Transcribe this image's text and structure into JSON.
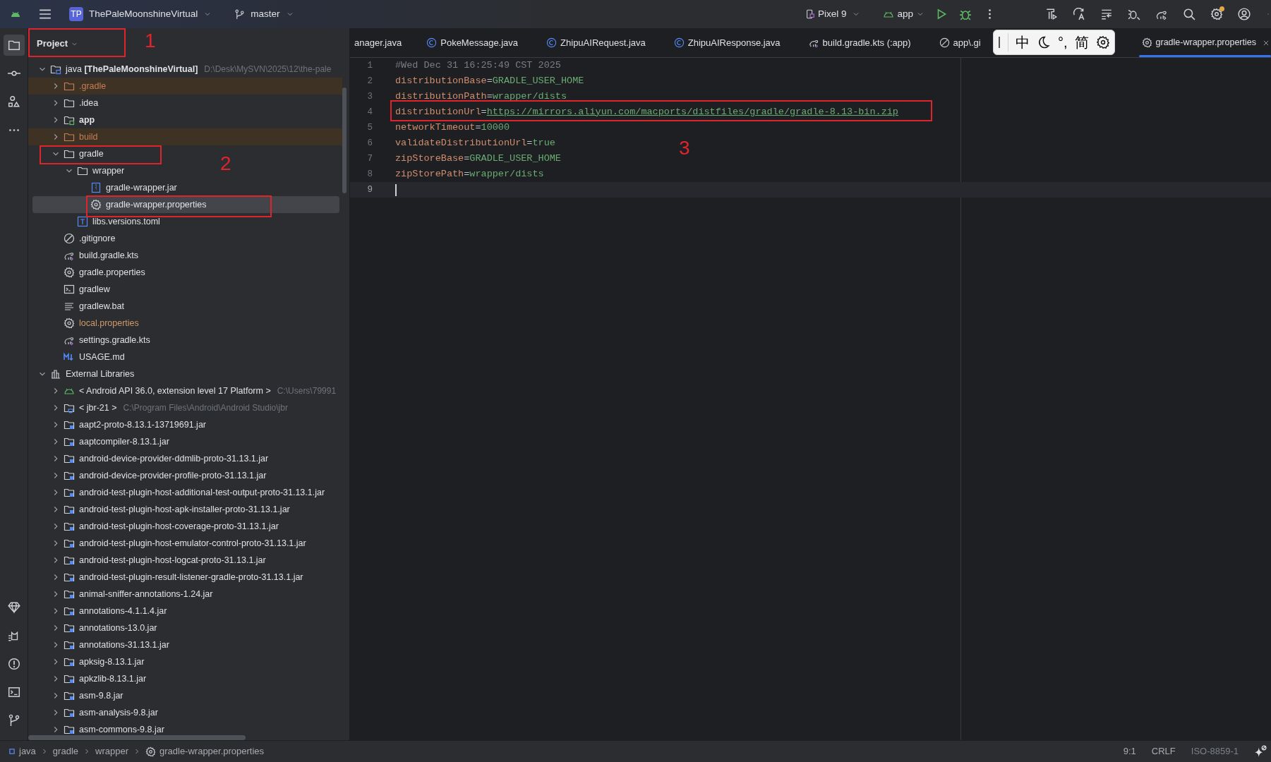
{
  "title_bar": {
    "project_badge": "TP",
    "project": "ThePaleMoonshineVirtual",
    "branch": "master",
    "device": "Pixel 9",
    "run_config": "app",
    "settings_notification": true
  },
  "project_panel": {
    "title": "Project"
  },
  "tree": [
    {
      "label": "java **[ThePaleMoonshineVirtual]**",
      "path": "D:\\Desk\\MySVN\\2025\\12\\the-pale",
      "kind": "module",
      "expanded": true,
      "excluded": false,
      "ignored": false,
      "selected": false,
      "children": [
        {
          "label": ".gradle",
          "kind": "folder",
          "expanded": false,
          "excluded": true,
          "ignored": false,
          "selected": false
        },
        {
          "label": ".idea",
          "kind": "folder",
          "expanded": false,
          "excluded": false,
          "ignored": false,
          "selected": false
        },
        {
          "label": "app",
          "kind": "app-module",
          "expanded": false,
          "excluded": false,
          "ignored": false,
          "selected": false
        },
        {
          "label": "build",
          "kind": "folder",
          "expanded": false,
          "excluded": true,
          "ignored": false,
          "selected": false
        },
        {
          "label": "gradle",
          "kind": "folder",
          "expanded": true,
          "excluded": false,
          "ignored": false,
          "selected": false,
          "children": [
            {
              "label": "wrapper",
              "kind": "folder",
              "expanded": true,
              "excluded": false,
              "ignored": false,
              "selected": false,
              "children": [
                {
                  "label": "gradle-wrapper.jar",
                  "kind": "jar",
                  "excluded": false,
                  "ignored": false,
                  "selected": false
                },
                {
                  "label": "gradle-wrapper.properties",
                  "kind": "properties",
                  "excluded": false,
                  "ignored": false,
                  "selected": true
                }
              ]
            },
            {
              "label": "libs.versions.toml",
              "kind": "toml",
              "excluded": false,
              "ignored": false,
              "selected": false
            }
          ]
        },
        {
          "label": ".gitignore",
          "kind": "ignore",
          "excluded": false,
          "ignored": false,
          "selected": false
        },
        {
          "label": "build.gradle.kts",
          "kind": "gradle-script",
          "excluded": false,
          "ignored": false,
          "selected": false
        },
        {
          "label": "gradle.properties",
          "kind": "properties",
          "excluded": false,
          "ignored": false,
          "selected": false
        },
        {
          "label": "gradlew",
          "kind": "shell",
          "excluded": false,
          "ignored": false,
          "selected": false
        },
        {
          "label": "gradlew.bat",
          "kind": "text",
          "excluded": false,
          "ignored": false,
          "selected": false
        },
        {
          "label": "local.properties",
          "kind": "properties",
          "excluded": false,
          "ignored": true,
          "selected": false
        },
        {
          "label": "settings.gradle.kts",
          "kind": "gradle-script",
          "excluded": false,
          "ignored": false,
          "selected": false
        },
        {
          "label": "USAGE.md",
          "kind": "markdown",
          "excluded": false,
          "ignored": false,
          "selected": false
        }
      ]
    },
    {
      "label": "External Libraries",
      "kind": "libraries",
      "expanded": true,
      "excluded": false,
      "ignored": false,
      "selected": false,
      "children": [
        {
          "label": "< Android API 36.0, extension level 17 Platform >",
          "path": "C:\\Users\\79991",
          "kind": "android",
          "expanded": false,
          "excluded": false,
          "ignored": false,
          "selected": false
        },
        {
          "label": "< jbr-21 >",
          "path": "C:\\Program Files\\Android\\Android Studio\\jbr",
          "kind": "sdk",
          "expanded": false,
          "excluded": false,
          "ignored": false,
          "selected": false
        },
        {
          "label": "aapt2-proto-8.13.1-13719691.jar",
          "kind": "library",
          "expanded": false,
          "excluded": false,
          "ignored": false,
          "selected": false
        },
        {
          "label": "aaptcompiler-8.13.1.jar",
          "kind": "library",
          "expanded": false,
          "excluded": false,
          "ignored": false,
          "selected": false
        },
        {
          "label": "android-device-provider-ddmlib-proto-31.13.1.jar",
          "kind": "library",
          "expanded": false,
          "excluded": false,
          "ignored": false,
          "selected": false
        },
        {
          "label": "android-device-provider-profile-proto-31.13.1.jar",
          "kind": "library",
          "expanded": false,
          "excluded": false,
          "ignored": false,
          "selected": false
        },
        {
          "label": "android-test-plugin-host-additional-test-output-proto-31.13.1.jar",
          "kind": "library",
          "expanded": false,
          "excluded": false,
          "ignored": false,
          "selected": false
        },
        {
          "label": "android-test-plugin-host-apk-installer-proto-31.13.1.jar",
          "kind": "library",
          "expanded": false,
          "excluded": false,
          "ignored": false,
          "selected": false
        },
        {
          "label": "android-test-plugin-host-coverage-proto-31.13.1.jar",
          "kind": "library",
          "expanded": false,
          "excluded": false,
          "ignored": false,
          "selected": false
        },
        {
          "label": "android-test-plugin-host-emulator-control-proto-31.13.1.jar",
          "kind": "library",
          "expanded": false,
          "excluded": false,
          "ignored": false,
          "selected": false
        },
        {
          "label": "android-test-plugin-host-logcat-proto-31.13.1.jar",
          "kind": "library",
          "expanded": false,
          "excluded": false,
          "ignored": false,
          "selected": false
        },
        {
          "label": "android-test-plugin-result-listener-gradle-proto-31.13.1.jar",
          "kind": "library",
          "expanded": false,
          "excluded": false,
          "ignored": false,
          "selected": false
        },
        {
          "label": "animal-sniffer-annotations-1.24.jar",
          "kind": "library",
          "expanded": false,
          "excluded": false,
          "ignored": false,
          "selected": false
        },
        {
          "label": "annotations-4.1.1.4.jar",
          "kind": "library",
          "expanded": false,
          "excluded": false,
          "ignored": false,
          "selected": false
        },
        {
          "label": "annotations-13.0.jar",
          "kind": "library",
          "expanded": false,
          "excluded": false,
          "ignored": false,
          "selected": false
        },
        {
          "label": "annotations-31.13.1.jar",
          "kind": "library",
          "expanded": false,
          "excluded": false,
          "ignored": false,
          "selected": false
        },
        {
          "label": "apksig-8.13.1.jar",
          "kind": "library",
          "expanded": false,
          "excluded": false,
          "ignored": false,
          "selected": false
        },
        {
          "label": "apkzlib-8.13.1.jar",
          "kind": "library",
          "expanded": false,
          "excluded": false,
          "ignored": false,
          "selected": false
        },
        {
          "label": "asm-9.8.jar",
          "kind": "library",
          "expanded": false,
          "excluded": false,
          "ignored": false,
          "selected": false
        },
        {
          "label": "asm-analysis-9.8.jar",
          "kind": "library",
          "expanded": false,
          "excluded": false,
          "ignored": false,
          "selected": false
        },
        {
          "label": "asm-commons-9.8.jar",
          "kind": "library",
          "expanded": false,
          "excluded": false,
          "ignored": false,
          "selected": false
        }
      ]
    }
  ],
  "tabs": [
    {
      "label": "anager.java",
      "kind": "none",
      "selected": false
    },
    {
      "label": "PokeMessage.java",
      "kind": "class",
      "selected": false
    },
    {
      "label": "ZhipuAIRequest.java",
      "kind": "class",
      "selected": false
    },
    {
      "label": "ZhipuAIResponse.java",
      "kind": "class",
      "selected": false
    },
    {
      "label": "build.gradle.kts (:app)",
      "kind": "gradle-script",
      "selected": false
    },
    {
      "label": "app\\.gi",
      "kind": "ignore",
      "selected": false
    },
    {
      "label": "gradle-wrapper.properties",
      "kind": "properties",
      "selected": true
    }
  ],
  "ime_toolbar": {
    "items": [
      "中",
      "°,",
      "简"
    ]
  },
  "editor_lines": [
    {
      "number": "1",
      "kind": "comment",
      "text": "#Wed Dec 31 16:25:49 CST 2025",
      "current": false
    },
    {
      "number": "2",
      "kind": "property",
      "key": "distributionBase",
      "sep": "=",
      "value": "GRADLE_USER_HOME",
      "current": false
    },
    {
      "number": "3",
      "kind": "property",
      "key": "distributionPath",
      "sep": "=",
      "value": "wrapper/dists",
      "current": false
    },
    {
      "number": "4",
      "kind": "link",
      "key": "distributionUrl",
      "sep": "=",
      "value": "https://mirrors.aliyun.com/macports/distfiles/gradle/gradle-8.13-bin.zip",
      "current": false
    },
    {
      "number": "5",
      "kind": "property",
      "key": "networkTimeout",
      "sep": "=",
      "value": "10000",
      "current": false
    },
    {
      "number": "6",
      "kind": "property",
      "key": "validateDistributionUrl",
      "sep": "=",
      "value": "true",
      "current": false
    },
    {
      "number": "7",
      "kind": "property",
      "key": "zipStoreBase",
      "sep": "=",
      "value": "GRADLE_USER_HOME",
      "current": false
    },
    {
      "number": "8",
      "kind": "property",
      "key": "zipStorePath",
      "sep": "=",
      "value": "wrapper/dists",
      "current": false
    },
    {
      "number": "9",
      "kind": "empty",
      "current": true
    }
  ],
  "annotations": [
    {
      "label": "1"
    },
    {
      "label": "2"
    },
    {
      "label": "3"
    }
  ],
  "breadcrumbs": [
    {
      "label": "java",
      "kind": "module"
    },
    {
      "label": "gradle",
      "kind": "folder"
    },
    {
      "label": "wrapper",
      "kind": "folder"
    },
    {
      "label": "gradle-wrapper.properties",
      "kind": "properties"
    }
  ],
  "status_bar": {
    "position": "9:1",
    "line_separator": "CRLF",
    "encoding": "ISO-8859-1"
  }
}
